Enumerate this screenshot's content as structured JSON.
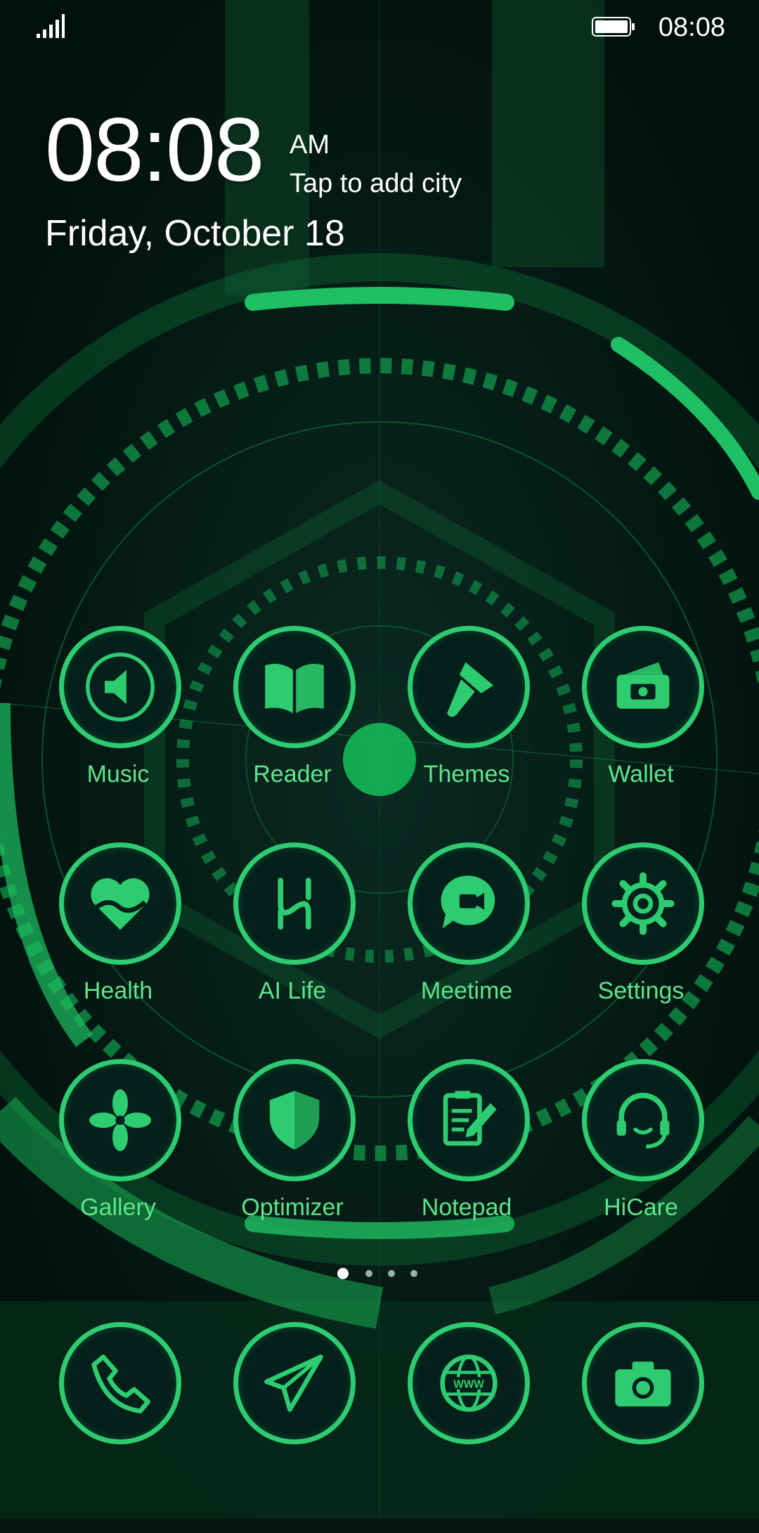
{
  "status_bar": {
    "time": "08:08"
  },
  "lockscreen": {
    "clock": "08:08",
    "ampm": "AM",
    "weather_prompt": "Tap to add city",
    "date": "Friday, October 18"
  },
  "apps": [
    {
      "label": "Music",
      "icon": "speaker-icon"
    },
    {
      "label": "Reader",
      "icon": "book-icon"
    },
    {
      "label": "Themes",
      "icon": "paintbrush-icon"
    },
    {
      "label": "Wallet",
      "icon": "wallet-icon"
    },
    {
      "label": "Health",
      "icon": "heart-icon"
    },
    {
      "label": "AI Life",
      "icon": "ai-life-icon"
    },
    {
      "label": "Meetime",
      "icon": "video-chat-icon"
    },
    {
      "label": "Settings",
      "icon": "gear-icon"
    },
    {
      "label": "Gallery",
      "icon": "flower-icon"
    },
    {
      "label": "Optimizer",
      "icon": "shield-icon"
    },
    {
      "label": "Notepad",
      "icon": "clipboard-pencil-icon"
    },
    {
      "label": "HiCare",
      "icon": "headset-icon"
    }
  ],
  "dock": [
    {
      "icon": "phone-icon"
    },
    {
      "icon": "paper-plane-icon"
    },
    {
      "icon": "globe-icon",
      "text": "WWW"
    },
    {
      "icon": "camera-icon"
    }
  ],
  "page_indicator": {
    "pages": 4,
    "active": 1
  },
  "colors": {
    "accent": "#2ecc71",
    "label": "#5ee58a",
    "background": "#041612"
  }
}
